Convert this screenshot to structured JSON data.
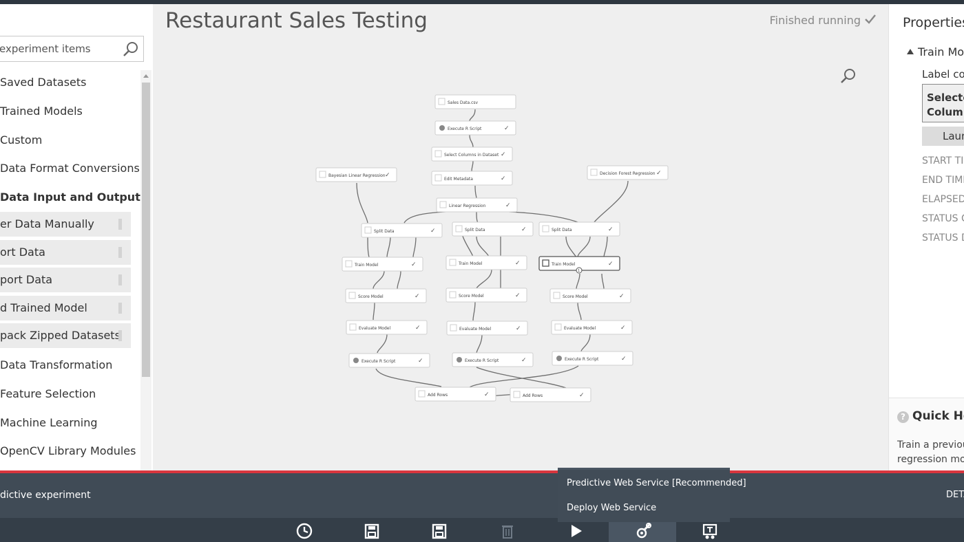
{
  "palette": {
    "search_placeholder": "experiment items",
    "items": [
      {
        "label": "Saved Datasets",
        "bold": false
      },
      {
        "label": "Trained Models",
        "bold": false
      },
      {
        "label": "Custom",
        "bold": false
      },
      {
        "label": "Data Format Conversions",
        "bold": false
      },
      {
        "label": "Data Input and Output",
        "bold": true
      },
      {
        "label": "er Data Manually",
        "sub": true
      },
      {
        "label": "ort Data",
        "sub": true
      },
      {
        "label": "port Data",
        "sub": true
      },
      {
        "label": "d Trained Model",
        "sub": true
      },
      {
        "label": "pack Zipped Datasets",
        "sub": true
      },
      {
        "label": "Data Transformation",
        "bold": false
      },
      {
        "label": "Feature Selection",
        "bold": false
      },
      {
        "label": "Machine Learning",
        "bold": false
      },
      {
        "label": "OpenCV Library Modules",
        "bold": false
      }
    ]
  },
  "canvas": {
    "title": "Restaurant Sales Testing",
    "status": "Finished running"
  },
  "graph": {
    "nodes": {
      "sales_data": "Sales Data.csv",
      "exec_r_top": "Execute R Script",
      "select_cols": "Select Columns in Dataset",
      "edit_meta": "Edit Metadata",
      "bayesian": "Bayesian Linear Regression",
      "decision_forest": "Decision Forest Regression",
      "linear": "Linear Regression",
      "split1": "Split Data",
      "split2": "Split Data",
      "split3": "Split Data",
      "train1": "Train Model",
      "train2": "Train Model",
      "train3": "Train Model",
      "score1": "Score Model",
      "score2": "Score Model",
      "score3": "Score Model",
      "eval1": "Evaluate Model",
      "eval2": "Evaluate Model",
      "eval3": "Evaluate Model",
      "exec_r1": "Execute R Script",
      "exec_r2": "Execute R Script",
      "exec_r3": "Execute R Script",
      "add_rows1": "Add Rows",
      "add_rows2": "Add Rows"
    },
    "badge": "1"
  },
  "properties": {
    "title": "Properties",
    "section": "Train Mod",
    "label_column": "Label colu",
    "selected_line1": "Selected",
    "selected_line2": "Column",
    "launch": "Laun",
    "meta": [
      "START TIM",
      "END TIME",
      "ELAPSED T",
      "STATUS CO",
      "STATUS DE"
    ]
  },
  "quick_help": {
    "title": "Quick Help",
    "line1": "Train a previou",
    "line2": "regression mod"
  },
  "bottom": {
    "experiment_type": "dictive experiment",
    "details": "DETA",
    "popup_item1": "Predictive Web Service [Recommended]",
    "popup_item2": "Deploy Web Service"
  },
  "icons": {
    "toolbar": [
      "history-icon",
      "save-icon",
      "save-as-icon",
      "discard-icon",
      "run-icon",
      "setup-web-service-icon",
      "publish-gallery-icon"
    ]
  },
  "colors": {
    "accent_red": "#d9363e",
    "bar_dark": "#404b56"
  }
}
